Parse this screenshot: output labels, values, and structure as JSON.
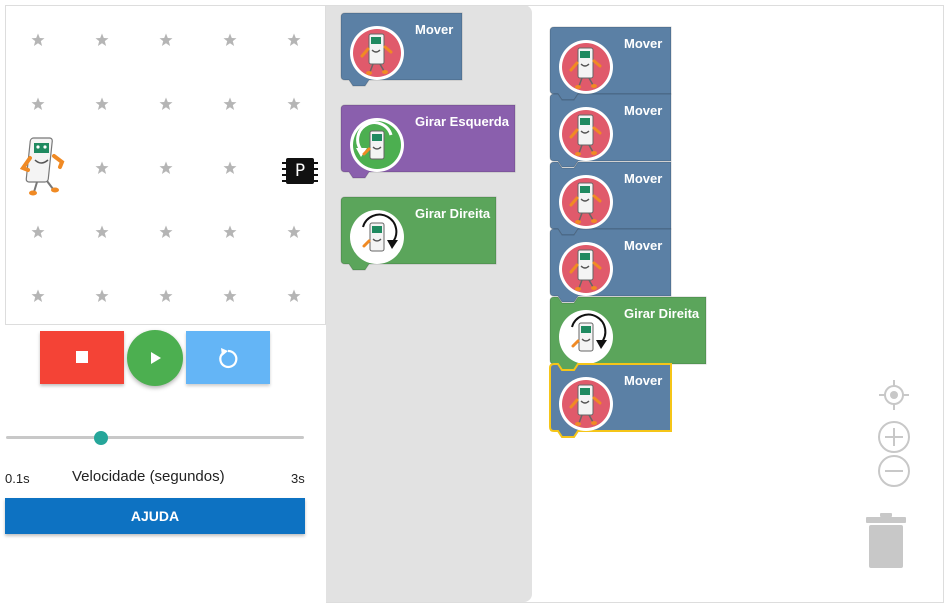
{
  "controls": {
    "stop_icon": "stop-square-icon",
    "play_icon": "play-triangle-icon",
    "reset_icon": "rotate-ccw-icon"
  },
  "speed": {
    "min_label": "0.1s",
    "max_label": "3s",
    "label": "Velocidade (segundos)",
    "value_fraction": 0.32
  },
  "help": {
    "label": "AJUDA"
  },
  "stage": {
    "goal_letter": "P"
  },
  "toolbox": {
    "blocks": [
      {
        "label": "Mover",
        "color": "#5b80a5"
      },
      {
        "label": "Girar Esquerda",
        "color": "#8a5fad"
      },
      {
        "label": "Girar Direita",
        "color": "#5ba55b"
      }
    ]
  },
  "workspace": {
    "blocks": [
      {
        "label": "Mover",
        "color": "#5b80a5"
      },
      {
        "label": "Mover",
        "color": "#5b80a5"
      },
      {
        "label": "Mover",
        "color": "#5b80a5"
      },
      {
        "label": "Mover",
        "color": "#5b80a5"
      },
      {
        "label": "Girar Direita",
        "color": "#5ba55b"
      },
      {
        "label": "Mover",
        "color": "#5b80a5",
        "selected": true
      }
    ]
  },
  "colors": {
    "stop": "#f44336",
    "play": "#4caf50",
    "reset": "#64b5f6",
    "help": "#0d72c2",
    "selection": "#f5c518"
  }
}
